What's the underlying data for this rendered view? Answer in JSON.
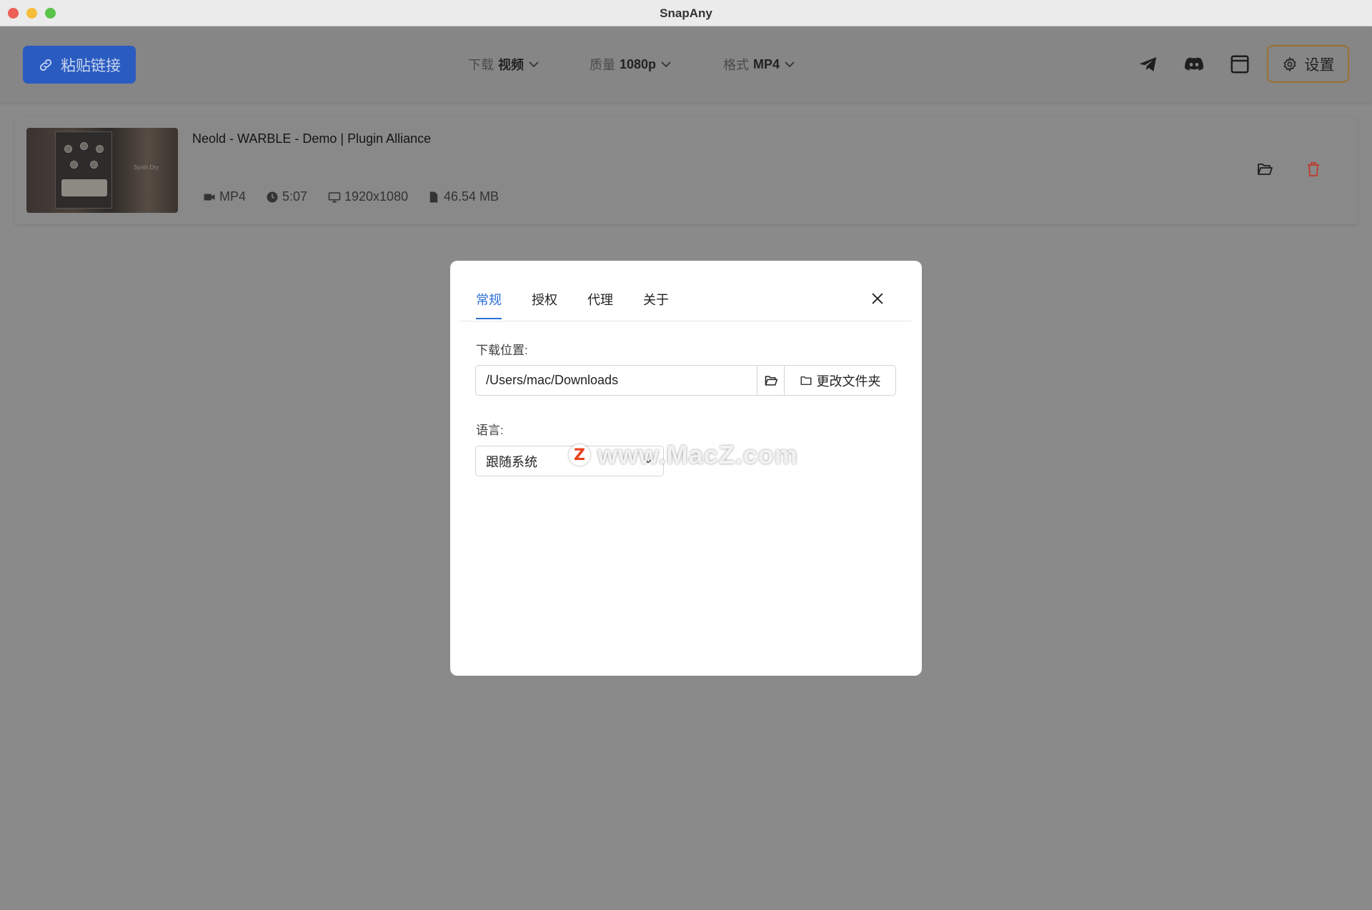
{
  "window": {
    "title": "SnapAny"
  },
  "toolbar": {
    "paste_label": "粘贴链接",
    "download": {
      "key": "下载",
      "value": "视频"
    },
    "quality": {
      "key": "质量",
      "value": "1080p"
    },
    "format": {
      "key": "格式",
      "value": "MP4"
    },
    "settings_label": "设置"
  },
  "item": {
    "title": "Neold - WARBLE - Demo | Plugin Alliance",
    "thumb_text": "Synth Dry",
    "format": "MP4",
    "duration": "5:07",
    "resolution": "1920x1080",
    "size": "46.54 MB"
  },
  "dialog": {
    "tabs": [
      "常规",
      "授权",
      "代理",
      "关于"
    ],
    "active_tab": "常规",
    "download_location_label": "下载位置:",
    "download_path": "/Users/mac/Downloads",
    "change_folder_label": "更改文件夹",
    "language_label": "语言:",
    "language_value": "跟随系统"
  },
  "watermark": {
    "logo": "Z",
    "text": "www.MacZ.com"
  },
  "colors": {
    "accent": "#2b6fd6",
    "paste_button": "#2a5bc0",
    "delete": "#c0392b"
  }
}
